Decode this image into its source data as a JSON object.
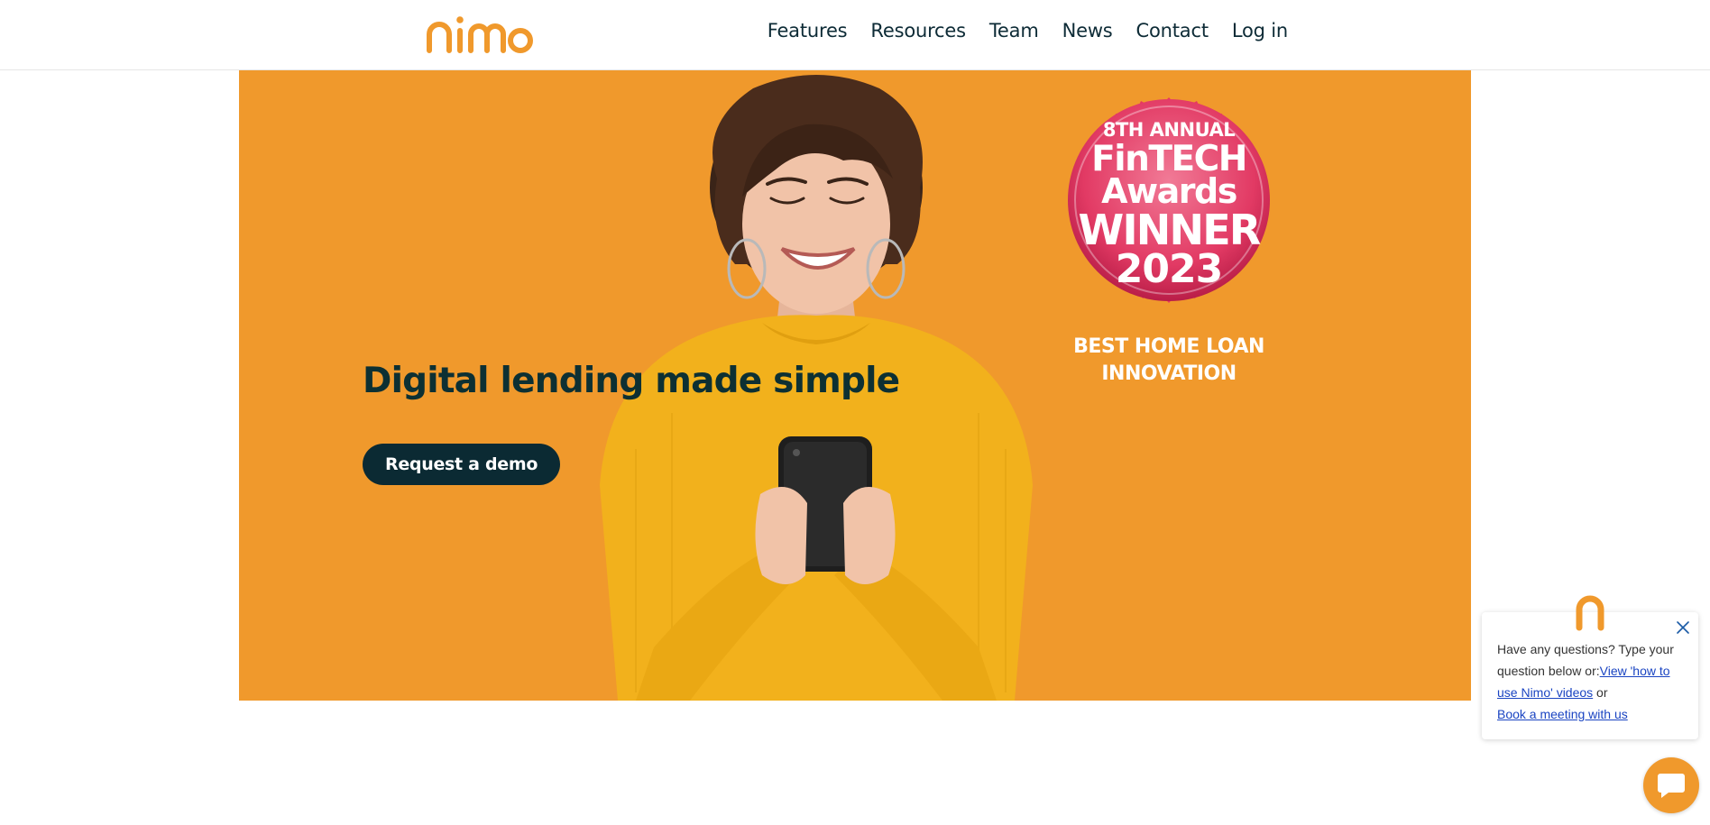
{
  "header": {
    "logo_text": "nimo",
    "nav": [
      {
        "label": "Features"
      },
      {
        "label": "Resources"
      },
      {
        "label": "Team"
      },
      {
        "label": "News"
      },
      {
        "label": "Contact"
      },
      {
        "label": "Log in"
      }
    ]
  },
  "hero": {
    "headline": "Digital lending made simple",
    "cta_label": "Request a demo",
    "background_color": "#f0992c",
    "award": {
      "line1": "8TH ANNUAL",
      "line2": "FinTECH",
      "line3": "Awards",
      "line4": "WINNER",
      "line5": "2023",
      "caption_line1": "BEST HOME LOAN",
      "caption_line2": "INNOVATION"
    }
  },
  "chat": {
    "message_prefix": "Have any questions? Type your question below or:",
    "videos_link": "View 'how to use Nimo' videos",
    "or_text": " or",
    "meeting_link": "Book a meeting with us",
    "accent_color": "#f0992c"
  }
}
